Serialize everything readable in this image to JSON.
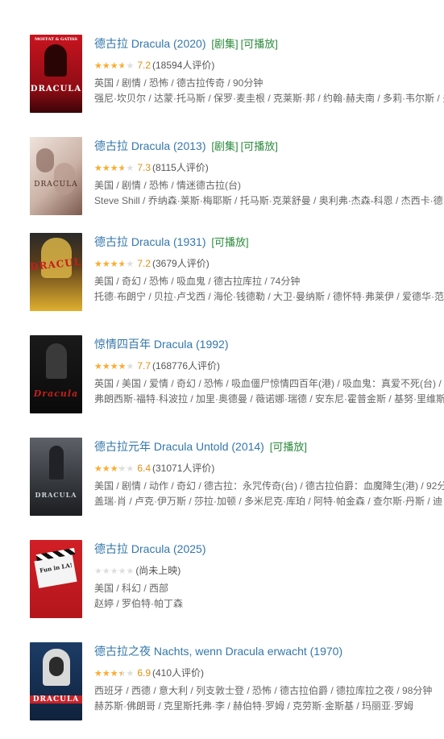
{
  "items": [
    {
      "title": "德古拉 Dracula (2020)",
      "tags": [
        "[剧集]",
        "[可播放]"
      ],
      "rating": 0.72,
      "score": "7.2",
      "count": "(18594人评价)",
      "meta1": "英国 / 剧情 / 恐怖 / 德古拉传奇 / 90分钟",
      "meta2": "强尼·坎贝尔 / 达蒙·托马斯 / 保罗·麦圭根 / 克莱斯·邦 / 约翰·赫夫南 / 多莉·韦尔斯 / 多",
      "poster": {
        "bg": "#b3121b",
        "accent": "#2a0505",
        "text": "DRACULA",
        "topline": "MOFFAT & GATISS"
      }
    },
    {
      "title": "德古拉 Dracula (2013)",
      "tags": [
        "[剧集]",
        "[可播放]"
      ],
      "rating": 0.73,
      "score": "7.3",
      "count": "(8115人评价)",
      "meta1": "美国 / 剧情 / 恐怖 / 情迷德古拉(台)",
      "meta2": "Steve Shill / 乔纳森·莱斯·梅耶斯 / 托马斯·克莱舒曼 / 奥利弗·杰森-科恩 / 杰西卡·德",
      "poster": {
        "bg": "#d9cbc3",
        "accent": "#5a3b33",
        "text": "DRACULA",
        "topline": ""
      }
    },
    {
      "title": "德古拉 Dracula (1931)",
      "tags": [
        "[可播放]"
      ],
      "rating": 0.72,
      "score": "7.2",
      "count": "(3679人评价)",
      "meta1": "美国 / 奇幻 / 恐怖 / 吸血鬼 / 德古拉库拉 / 74分钟",
      "meta2": "托德·布朗宁 / 贝拉·卢戈西 / 海伦·钱德勒 / 大卫·曼纳斯 / 德怀特·弗莱伊 / 爱德华·范",
      "poster": {
        "bg": "#f0c53a",
        "accent": "#b01d1d",
        "text": "DRACULA",
        "topline": ""
      }
    },
    {
      "title": "惊情四百年 Dracula (1992)",
      "tags": [],
      "rating": 0.77,
      "score": "7.7",
      "count": "(168776人评价)",
      "meta1": "英国 / 美国 / 爱情 / 奇幻 / 恐怖 / 吸血僵尸惊情四百年(港) / 吸血鬼：真爱不死(台) /",
      "meta2": "弗朗西斯·福特·科波拉 / 加里·奥德曼 / 薇诺娜·瑞德 / 安东尼·霍普金斯 / 基努·里维斯",
      "poster": {
        "bg": "#111111",
        "accent": "#c2201a",
        "text": "Dracula",
        "topline": ""
      }
    },
    {
      "title": "德古拉元年 Dracula Untold (2014)",
      "tags": [
        "[可播放]"
      ],
      "rating": 0.64,
      "score": "6.4",
      "count": "(31071人评价)",
      "meta1": "美国 / 剧情 / 动作 / 奇幻 / 德古拉：永咒传奇(台) / 德古拉伯爵：血魔降生(港) / 92分",
      "meta2": "盖瑞·肖 / 卢克·伊万斯 / 莎拉·加顿 / 多米尼克·库珀 / 阿特·帕金森 / 查尔斯·丹斯 / 迪",
      "poster": {
        "bg": "#3c3f44",
        "accent": "#8f9398",
        "text": "DRACULA",
        "topline": ""
      }
    },
    {
      "title": "德古拉 Dracula (2025)",
      "tags": [],
      "rating": 0,
      "score": "",
      "count": "(尚未上映)",
      "meta1": "美国 / 科幻 / 西部",
      "meta2": "赵婷 / 罗伯特·帕丁森",
      "poster": {
        "bg": "#d21f26",
        "accent": "#1a1a1a",
        "text": "Fun in LA!",
        "topline": ""
      }
    },
    {
      "title": "德古拉之夜 Nachts, wenn Dracula erwacht (1970)",
      "tags": [],
      "rating": 0.69,
      "score": "6.9",
      "count": "(410人评价)",
      "meta1": "西班牙 / 西德 / 意大利 / 列支敦士登 / 恐怖 / 德古拉伯爵 / 德拉库拉之夜 / 98分钟",
      "meta2": "赫苏斯·佛朗哥 / 克里斯托弗·李 / 赫伯特·罗姆 / 克劳斯·金斯基 / 玛丽亚·罗姆",
      "poster": {
        "bg": "#1d3c66",
        "accent": "#c8232a",
        "text": "DRACULA",
        "topline": ""
      }
    }
  ],
  "stars_glyph": "★★★★★"
}
